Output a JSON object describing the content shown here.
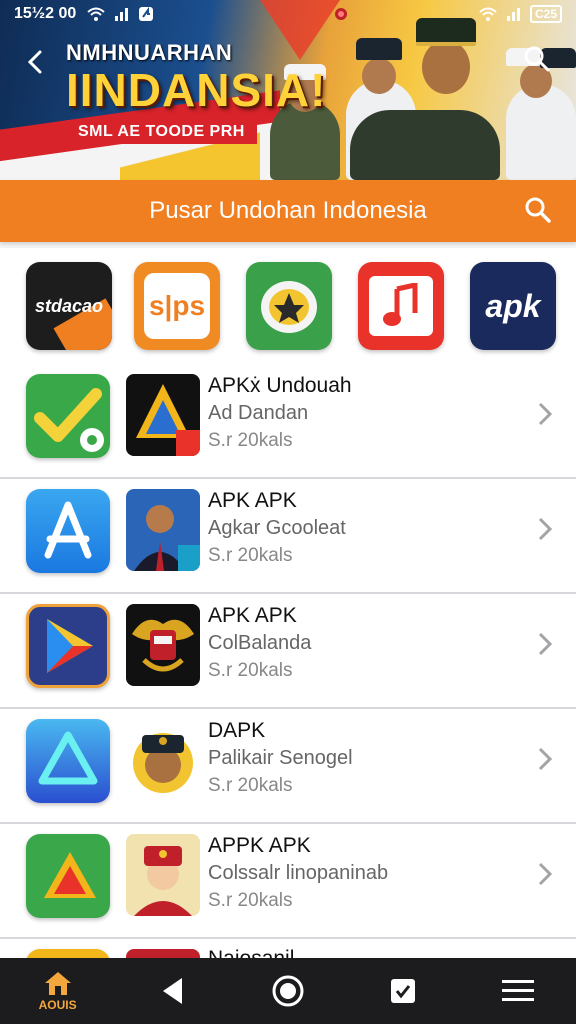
{
  "status_bar": {
    "time": "15½2 00",
    "battery": "C25"
  },
  "banner": {
    "subtitle": "NMHNUARHAN",
    "title": "IINDANSIA!",
    "tag": "SML AE TOODE PRH",
    "back_icon": "chevron-left-icon",
    "search_icon": "search-icon"
  },
  "header": {
    "title": "Pusar Undohan Indonesia",
    "search_icon": "search-icon"
  },
  "featured": [
    {
      "label": "stdacao",
      "bg": "#1d1d1d"
    },
    {
      "label": "s|ps",
      "bg": "#f08a22"
    },
    {
      "label": "",
      "bg": "#3aa04a"
    },
    {
      "label": "",
      "bg": "#e8322a"
    },
    {
      "label": "apk",
      "bg": "#1a2a5c"
    }
  ],
  "list": [
    {
      "title": "APKẋ Undouah",
      "subtitle": "Ad Dandan",
      "size": "S.r 20kals"
    },
    {
      "title": "APK APK",
      "subtitle": "Agkar Gcooleat",
      "size": "S.r 20kals"
    },
    {
      "title": "APK APK",
      "subtitle": "ColBalanda",
      "size": "S.r 20kals"
    },
    {
      "title": "DAPK",
      "subtitle": "Palikair Senogel",
      "size": "S.r 20kals"
    },
    {
      "title": "APPK APK",
      "subtitle": "Colssalr linopaninab",
      "size": "S.r 20kals"
    },
    {
      "title": "Naiosanil",
      "subtitle": "",
      "size": ""
    }
  ],
  "nav": {
    "home_label": "AOUIS"
  },
  "colors": {
    "accent": "#f07f22",
    "nav_bg": "#1c1c1e"
  }
}
